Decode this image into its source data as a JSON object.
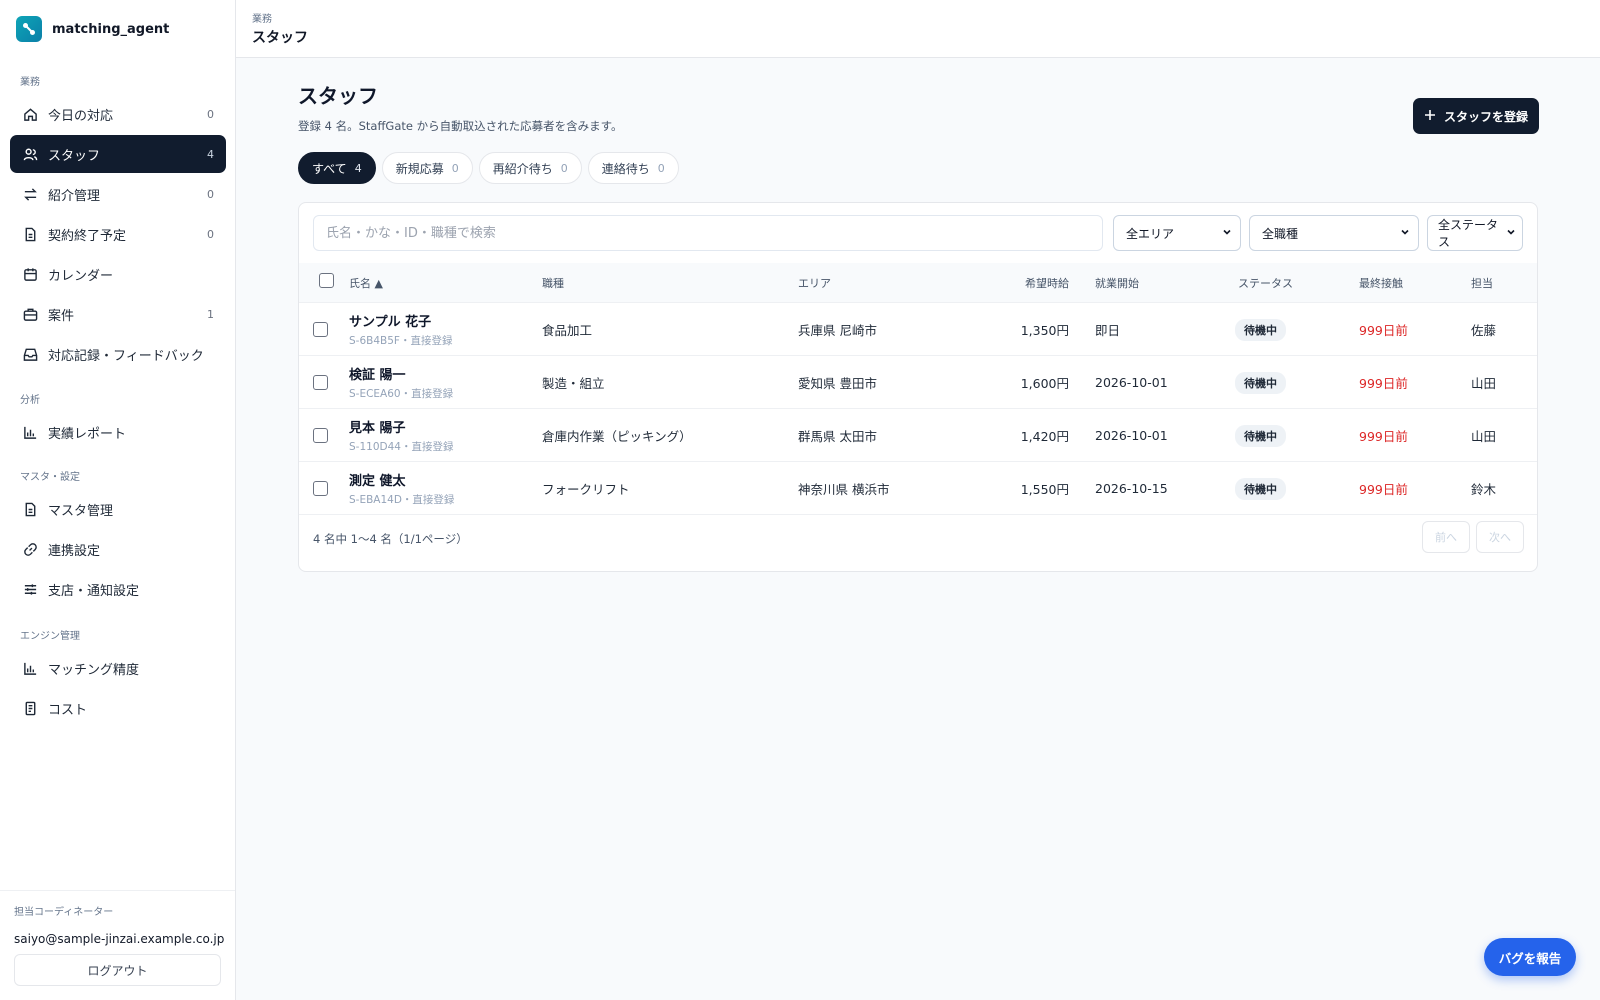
{
  "app": {
    "name": "matching_agent"
  },
  "sidebar": {
    "sections": [
      {
        "label": "業務"
      },
      {
        "label": "分析"
      },
      {
        "label": "マスタ・設定"
      },
      {
        "label": "エンジン管理"
      }
    ],
    "items": [
      {
        "label": "今日の対応",
        "count": "0",
        "icon": "home-icon"
      },
      {
        "label": "スタッフ",
        "count": "4",
        "icon": "users-icon",
        "active": true
      },
      {
        "label": "紹介管理",
        "count": "0",
        "icon": "swap-icon"
      },
      {
        "label": "契約終了予定",
        "count": "0",
        "icon": "document-icon"
      },
      {
        "label": "カレンダー",
        "count": "",
        "icon": "calendar-icon"
      },
      {
        "label": "案件",
        "count": "1",
        "icon": "briefcase-icon"
      },
      {
        "label": "対応記録・フィードバック",
        "count": "",
        "icon": "inbox-icon"
      },
      {
        "label": "実績レポート",
        "count": "",
        "icon": "bar-chart-icon"
      },
      {
        "label": "マスタ管理",
        "count": "",
        "icon": "document-icon"
      },
      {
        "label": "連携設定",
        "count": "",
        "icon": "link-icon"
      },
      {
        "label": "支店・通知設定",
        "count": "",
        "icon": "sliders-icon"
      },
      {
        "label": "マッチング精度",
        "count": "",
        "icon": "bar-chart-icon"
      },
      {
        "label": "コスト",
        "count": "",
        "icon": "receipt-icon"
      }
    ],
    "footer": {
      "label": "担当コーディネーター",
      "email": "saiyo@sample-jinzai.example.co.jp",
      "logout": "ログアウト"
    }
  },
  "header": {
    "breadcrumb": "業務",
    "title": "スタッフ"
  },
  "main": {
    "title": "スタッフ",
    "subtitle": "登録 4 名。StaffGate から自動取込された応募者を含みます。",
    "register_button": "スタッフを登録",
    "tabs": [
      {
        "label": "すべて",
        "count": "4",
        "active": true
      },
      {
        "label": "新規応募",
        "count": "0"
      },
      {
        "label": "再紹介待ち",
        "count": "0"
      },
      {
        "label": "連絡待ち",
        "count": "0"
      }
    ],
    "search": {
      "placeholder": "氏名・かな・ID・職種で検索",
      "value": ""
    },
    "filters": {
      "area": "全エリア",
      "job": "全職種",
      "status": "全ステータス"
    },
    "columns": {
      "name": "氏名 ▲",
      "job": "職種",
      "area": "エリア",
      "wage": "希望時給",
      "start": "就業開始",
      "status": "ステータス",
      "last_contact": "最終接触",
      "owner": "担当"
    },
    "rows": [
      {
        "name": "サンプル 花子",
        "sub": "S-6B4B5F・直接登録",
        "job": "食品加工",
        "area": "兵庫県 尼崎市",
        "wage": "1,350円",
        "start": "即日",
        "status": "待機中",
        "last_contact": "999日前",
        "owner": "佐藤"
      },
      {
        "name": "検証 陽一",
        "sub": "S-ECEA60・直接登録",
        "job": "製造・組立",
        "area": "愛知県 豊田市",
        "wage": "1,600円",
        "start": "2026-10-01",
        "status": "待機中",
        "last_contact": "999日前",
        "owner": "山田"
      },
      {
        "name": "見本 陽子",
        "sub": "S-110D44・直接登録",
        "job": "倉庫内作業（ピッキング）",
        "area": "群馬県 太田市",
        "wage": "1,420円",
        "start": "2026-10-01",
        "status": "待機中",
        "last_contact": "999日前",
        "owner": "山田"
      },
      {
        "name": "測定 健太",
        "sub": "S-EBA14D・直接登録",
        "job": "フォークリフト",
        "area": "神奈川県 横浜市",
        "wage": "1,550円",
        "start": "2026-10-15",
        "status": "待機中",
        "last_contact": "999日前",
        "owner": "鈴木"
      }
    ],
    "pager": {
      "summary": "4 名中 1〜4 名（1/1ページ）",
      "prev": "前へ",
      "next": "次へ"
    }
  },
  "bug_report_button": "バグを報告",
  "colors": {
    "accent_dark": "#111c2e",
    "danger": "#dc2626",
    "primary": "#2563eb"
  }
}
